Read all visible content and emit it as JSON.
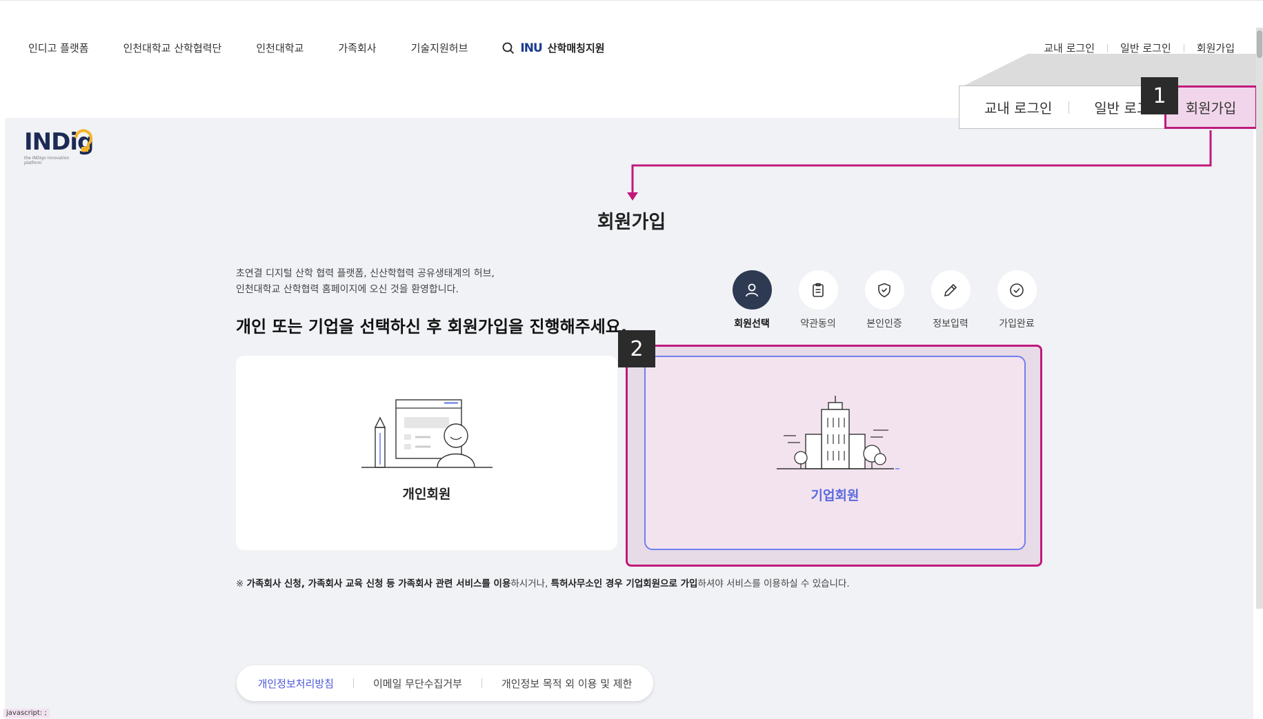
{
  "nav": {
    "links": [
      "인디고 플랫폼",
      "인천대학교 산학협력단",
      "인천대학교",
      "가족회사",
      "기술지원허브"
    ],
    "inu_logo": "INU",
    "inu_label": "산학매칭지원"
  },
  "auth": {
    "campus_login": "교내 로그인",
    "general_login": "일반 로그인",
    "signup": "회원가입"
  },
  "callout": {
    "campus_login": "교내 로그인",
    "general_login": "일반 로그인",
    "signup": "회원가입",
    "badge_1": "1",
    "badge_2": "2"
  },
  "logo": {
    "text": "INDig",
    "sub": "the INDigo innovation platform"
  },
  "page": {
    "title": "회원가입",
    "intro_line1": "초연결 디지털 산학 협력 플랫폼, 신산학협력 공유생태계의 허브,",
    "intro_line2": "인천대학교 산학협력 홈페이지에 오신 것을 환영합니다.",
    "headline": "개인 또는 기업을 선택하신 후 회원가입을 진행해주세요."
  },
  "steps": [
    {
      "label": "회원선택",
      "icon": "person-icon",
      "active": true
    },
    {
      "label": "약관동의",
      "icon": "clipboard-icon",
      "active": false
    },
    {
      "label": "본인인증",
      "icon": "shield-check-icon",
      "active": false
    },
    {
      "label": "정보입력",
      "icon": "pencil-icon",
      "active": false
    },
    {
      "label": "가입완료",
      "icon": "check-circle-icon",
      "active": false
    }
  ],
  "cards": {
    "personal": "개인회원",
    "corporate": "기업회원"
  },
  "notice": {
    "prefix": "※ ",
    "bold1": "가족회사 신청, 가족회사 교육 신청 등 가족회사 관련 서비스를 이용",
    "text1": "하시거나, ",
    "bold2": "특허사무소인 경우 기업회원으로 가입",
    "text2": "하셔야 서비스를 이용하실 수 있습니다."
  },
  "footer": {
    "privacy": "개인정보처리방침",
    "email": "이메일 무단수집거부",
    "usage": "개인정보 목적 외 이용 및 제한"
  },
  "status": "javascript: ;",
  "colors": {
    "accent": "#c0197d",
    "primary": "#4a57d6",
    "dark_step": "#2e3a52"
  }
}
